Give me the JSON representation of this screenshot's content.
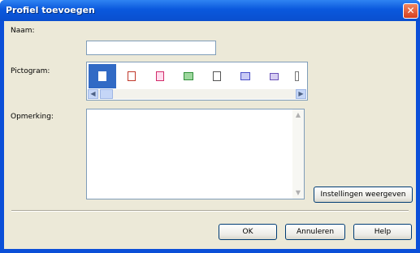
{
  "dialog": {
    "title": "Profiel toevoegen",
    "close_symbol": "✕"
  },
  "form": {
    "name_label": "Naam:",
    "name_value": "",
    "icon_label": "Pictogram:",
    "remark_label": "Opmerking:",
    "remark_value": ""
  },
  "icons": [
    {
      "name": "document-icon",
      "color": "#7a7a7a"
    },
    {
      "name": "pencil-document-icon",
      "color": "#c0392b"
    },
    {
      "name": "red-document-icon",
      "color": "#d22c6a"
    },
    {
      "name": "image-icon",
      "color": "#2f8f3a"
    },
    {
      "name": "page-icon",
      "color": "#555555"
    },
    {
      "name": "book-icon",
      "color": "#4a4fc8"
    },
    {
      "name": "pen-icon",
      "color": "#6a52b8"
    }
  ],
  "buttons": {
    "show_settings": "Instellingen weergeven",
    "ok": "OK",
    "cancel": "Annuleren",
    "help": "Help"
  },
  "scroll": {
    "left": "◀",
    "right": "▶",
    "up": "▲",
    "down": "▼"
  }
}
